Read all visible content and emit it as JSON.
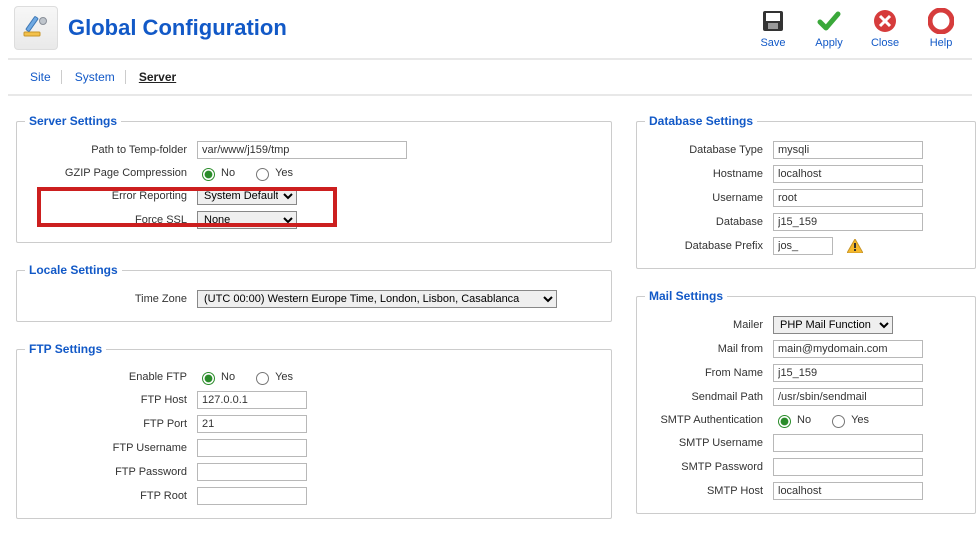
{
  "header": {
    "title": "Global Configuration",
    "toolbar": {
      "save": "Save",
      "apply": "Apply",
      "close": "Close",
      "help": "Help"
    }
  },
  "tabs": {
    "site": "Site",
    "system": "System",
    "server": "Server"
  },
  "server": {
    "legend": "Server Settings",
    "path_tmp_label": "Path to Temp-folder",
    "path_tmp_value": "var/www/j159/tmp",
    "gzip_label": "GZIP Page Compression",
    "radio_no": "No",
    "radio_yes": "Yes",
    "error_label": "Error Reporting",
    "error_value": "System Default",
    "ssl_label": "Force SSL",
    "ssl_value": "None"
  },
  "locale": {
    "legend": "Locale Settings",
    "tz_label": "Time Zone",
    "tz_value": "(UTC 00:00) Western Europe Time, London, Lisbon, Casablanca"
  },
  "ftp": {
    "legend": "FTP Settings",
    "enable_label": "Enable FTP",
    "host_label": "FTP Host",
    "host_value": "127.0.0.1",
    "port_label": "FTP Port",
    "port_value": "21",
    "user_label": "FTP Username",
    "user_value": "",
    "pass_label": "FTP Password",
    "pass_value": "",
    "root_label": "FTP Root",
    "root_value": ""
  },
  "db": {
    "legend": "Database Settings",
    "type_label": "Database Type",
    "type_value": "mysqli",
    "host_label": "Hostname",
    "host_value": "localhost",
    "user_label": "Username",
    "user_value": "root",
    "name_label": "Database",
    "name_value": "j15_159",
    "prefix_label": "Database Prefix",
    "prefix_value": "jos_"
  },
  "mail": {
    "legend": "Mail Settings",
    "mailer_label": "Mailer",
    "mailer_value": "PHP Mail Function",
    "from_label": "Mail from",
    "from_value": "main@mydomain.com",
    "name_label": "From Name",
    "name_value": "j15_159",
    "sendmail_label": "Sendmail Path",
    "sendmail_value": "/usr/sbin/sendmail",
    "smtpauth_label": "SMTP Authentication",
    "smtpuser_label": "SMTP Username",
    "smtpuser_value": "",
    "smtppass_label": "SMTP Password",
    "smtppass_value": "",
    "smtphost_label": "SMTP Host",
    "smtphost_value": "localhost"
  }
}
